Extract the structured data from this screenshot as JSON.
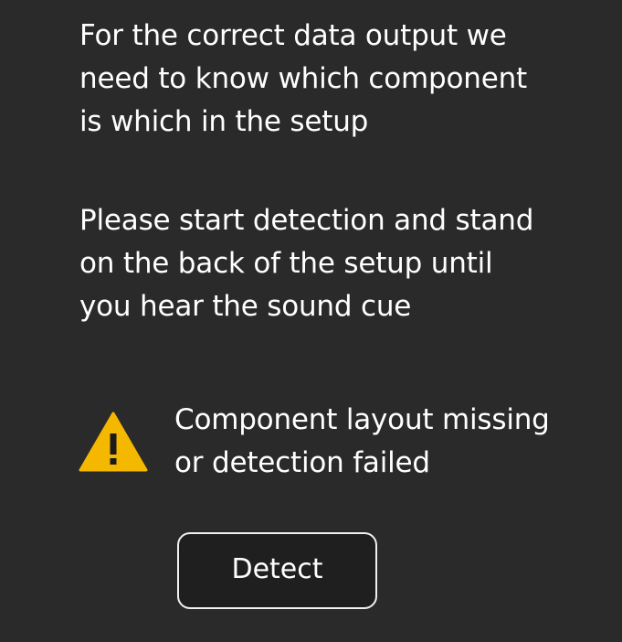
{
  "instructions": {
    "paragraph_1": "For the correct data output we\nneed to know which component\nis which in the setup",
    "paragraph_2": "Please start detection and stand\non the back of the setup until\nyou hear the sound cue"
  },
  "status": {
    "icon": "warning-icon",
    "icon_color": "#f5b800",
    "message": "Component layout missing\nor detection failed"
  },
  "actions": {
    "detect_label": "Detect"
  }
}
